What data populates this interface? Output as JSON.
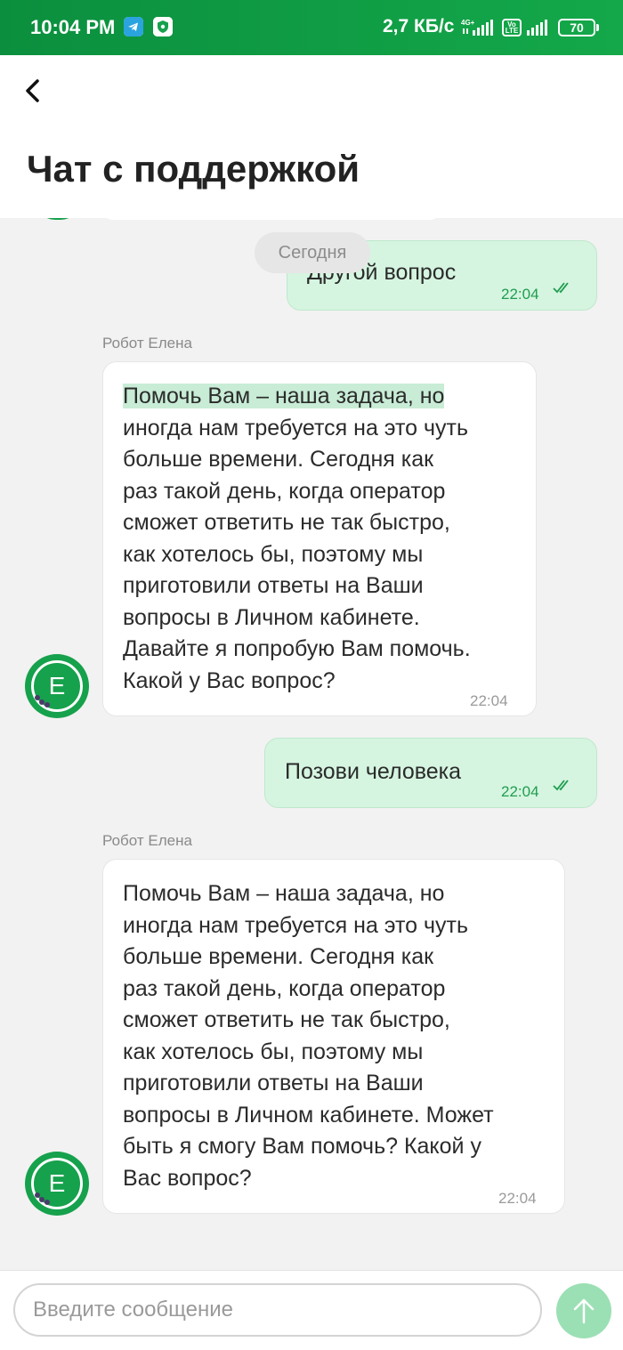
{
  "status_bar": {
    "time": "10:04 PM",
    "network_speed": "2,7 КБ/с",
    "net1": "4G+",
    "volte": "Vo LTE",
    "battery": "70",
    "icons": [
      "telegram-icon",
      "shield-icon",
      "signal-icon",
      "volte-icon",
      "signal-icon",
      "battery-icon"
    ]
  },
  "header": {
    "title": "Чат с поддержкой",
    "back_icon": "chevron-left-icon"
  },
  "chat": {
    "date_separator": "Сегодня",
    "messages": [
      {
        "direction": "out",
        "text": "Другой вопрос",
        "time": "22:04",
        "status": "read"
      },
      {
        "direction": "in",
        "sender": "Робот Елена",
        "avatar_letter": "E",
        "text_highlight": "Помочь Вам – наша задача, но",
        "text": "иногда нам требуется на это чуть больше времени. Сегодня как раз такой день, когда оператор сможет ответить не так быстро, как хотелось бы, поэтому мы приготовили ответы на Ваши вопросы в Личном кабинете. Давайте я попробую Вам помочь. Какой у Вас вопрос?",
        "lines": [
          "иногда нам требуется на это чуть",
          "больше времени. Сегодня как",
          "раз такой день, когда оператор",
          "сможет ответить не так быстро,",
          "как хотелось бы, поэтому мы",
          "приготовили ответы на Ваши",
          "вопросы в Личном кабинете.",
          "Давайте я попробую Вам помочь.",
          "Какой у Вас вопрос?"
        ],
        "time": "22:04"
      },
      {
        "direction": "out",
        "text": "Позови человека",
        "time": "22:04",
        "status": "read"
      },
      {
        "direction": "in",
        "sender": "Робот Елена",
        "avatar_letter": "E",
        "lines": [
          "Помочь Вам – наша задача, но",
          "иногда нам требуется на это чуть",
          "больше времени. Сегодня как",
          "раз такой день, когда оператор",
          "сможет ответить не так быстро,",
          "как хотелось бы, поэтому мы",
          "приготовили ответы на Ваши",
          "вопросы в Личном кабинете. Может",
          "быть я смогу Вам помочь? Какой у",
          "Вас вопрос?"
        ],
        "time": "22:04"
      }
    ]
  },
  "composer": {
    "placeholder": "Введите сообщение",
    "value": "",
    "send_icon": "arrow-up-icon"
  },
  "colors": {
    "brand": "#14a84a",
    "outgoing_bubble": "#d5f5e0",
    "send_button": "#9be0b4",
    "background": "#f2f2f2"
  }
}
